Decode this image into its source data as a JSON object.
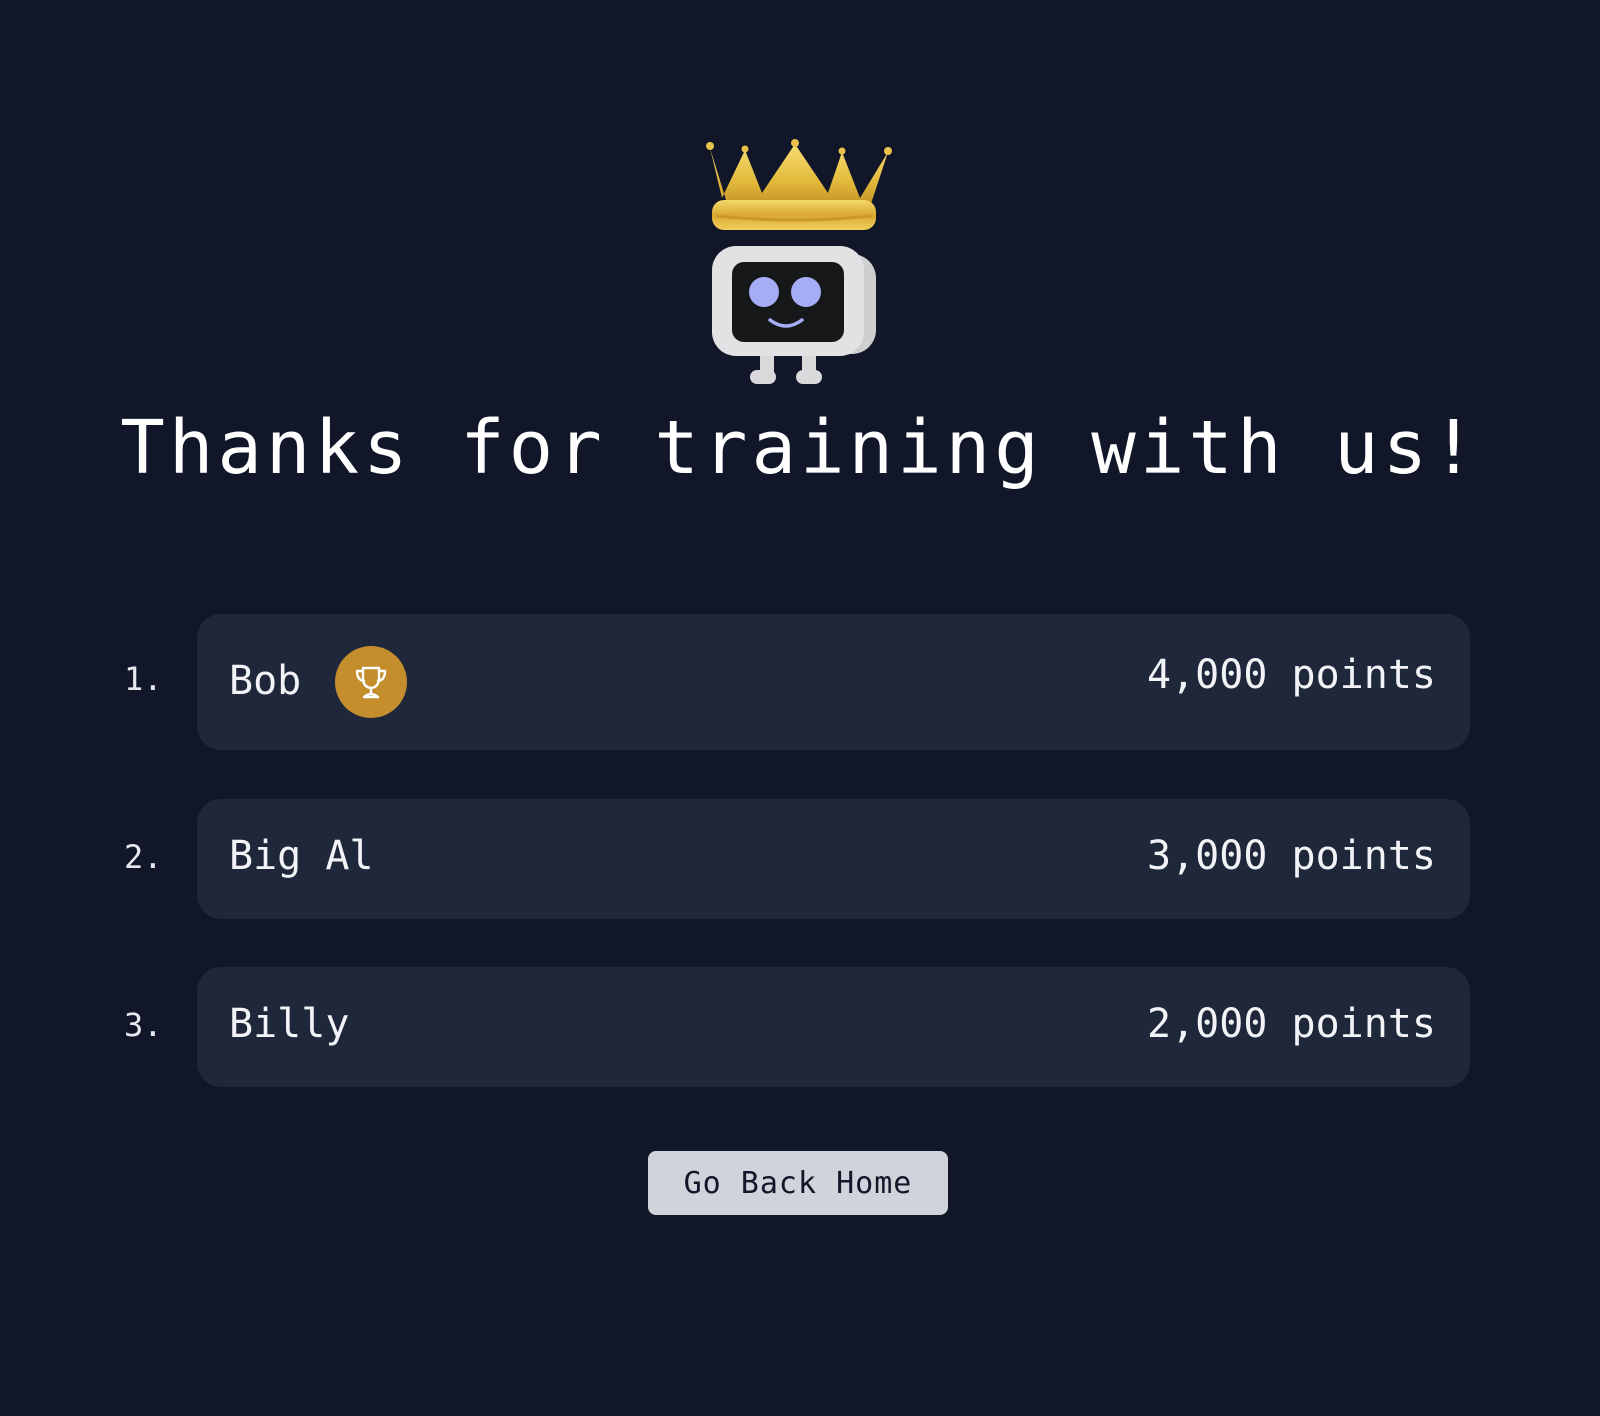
{
  "title": "Thanks for training with us!",
  "leaderboard": [
    {
      "rank": "1.",
      "name": "Bob",
      "points": "4,000 points",
      "badge": "trophy-icon"
    },
    {
      "rank": "2.",
      "name": "Big Al",
      "points": "3,000 points"
    },
    {
      "rank": "3.",
      "name": "Billy",
      "points": "2,000 points"
    }
  ],
  "home_button": {
    "label": "Go Back Home"
  },
  "colors": {
    "background": "#111729",
    "card": "#1f283a",
    "badge": "#c58e2d",
    "button": "#cfd3da",
    "mascot_eyes": "#a5adf7",
    "crown": "#e2b93b"
  },
  "icons": {
    "mascot": "crowned-robot-mascot",
    "badge": "trophy-icon"
  }
}
